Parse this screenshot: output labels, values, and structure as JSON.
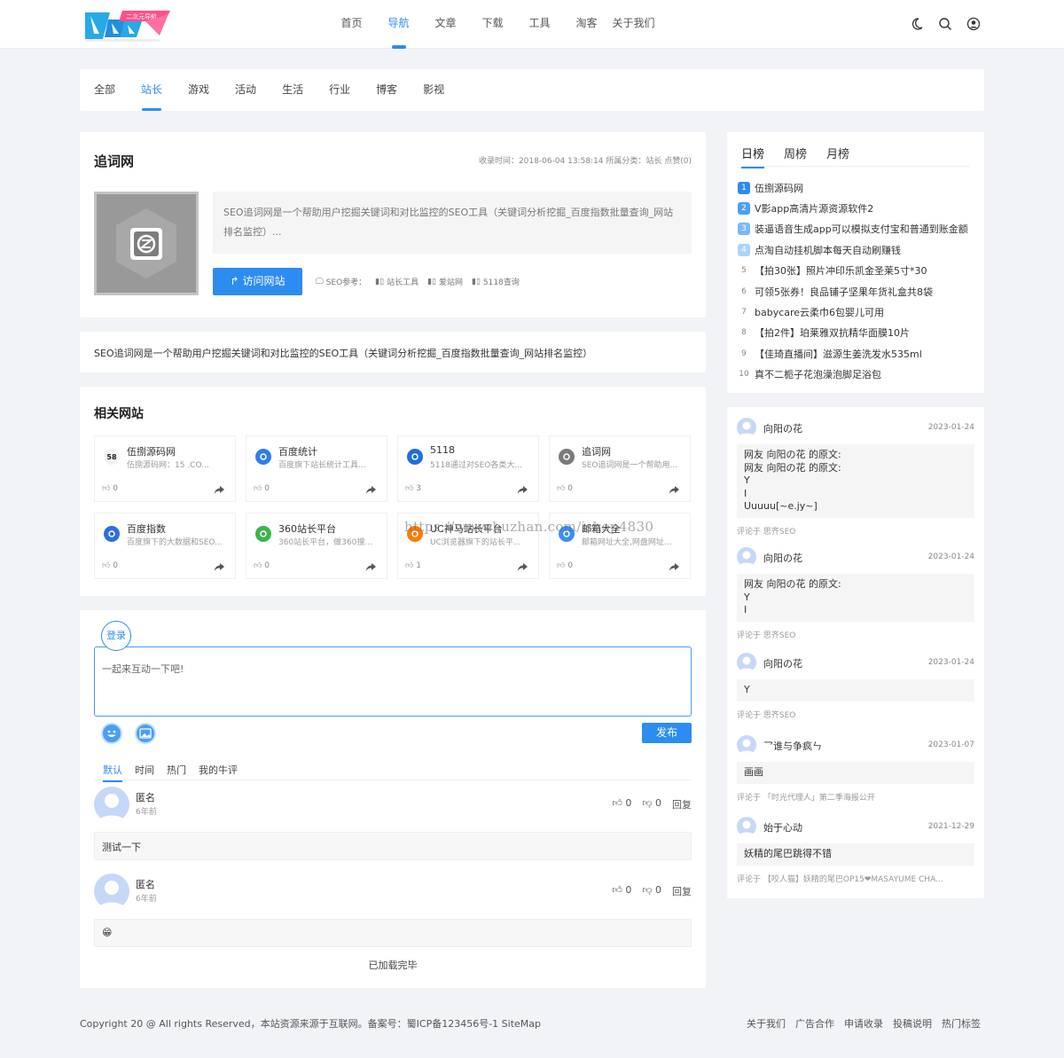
{
  "header": {
    "nav": [
      "首页",
      "导航",
      "文章",
      "下载",
      "工具",
      "淘客",
      "关于我们"
    ],
    "active_nav": 1,
    "logo_badge": "二次元导航"
  },
  "categories": [
    "全部",
    "站长",
    "游戏",
    "活动",
    "生活",
    "行业",
    "博客",
    "影视"
  ],
  "active_category": 1,
  "site": {
    "title": "追词网",
    "meta": "收录时间：2018-06-04 13:58:14 所属分类：站长 点赞(0)",
    "desc": "SEO追词网是一个帮助用户挖掘关键词和对比监控的SEO工具（关键词分析挖掘_百度指数批量查询_网站排名监控）...",
    "visit_label": "访问网站",
    "seo_label": "SEO参考：",
    "seo_links": [
      "站长工具",
      "爱站网",
      "5118查询"
    ]
  },
  "long_desc": "SEO追词网是一个帮助用户挖掘关键词和对比监控的SEO工具（关键词分析挖掘_百度指数批量查询_网站排名监控）",
  "related": {
    "title": "相关网站",
    "items": [
      {
        "name": "伍捌源码网",
        "desc": "伍捌源码网：15      .CO...",
        "likes": "0",
        "icon_text": "58",
        "color": "#f2f2f2"
      },
      {
        "name": "百度统计",
        "desc": "百度旗下站长统计工具...",
        "likes": "0",
        "icon_text": "",
        "color": "#2e7fe8"
      },
      {
        "name": "5118",
        "desc": "5118通过对SEO各类大...",
        "likes": "3",
        "icon_text": "",
        "color": "#1e6fdb"
      },
      {
        "name": "追词网",
        "desc": "SEO追词网是一个帮助用...",
        "likes": "0",
        "icon_text": "",
        "color": "#7a7a7a"
      },
      {
        "name": "百度指数",
        "desc": "百度旗下的大数据和SEO...",
        "likes": "0",
        "icon_text": "",
        "color": "#2c6fe0"
      },
      {
        "name": "360站长平台",
        "desc": "360站长平台，做360搜...",
        "likes": "0",
        "icon_text": "",
        "color": "#39b54a"
      },
      {
        "name": "UC神马站长平台",
        "desc": "UC浏览器旗下的站长平...",
        "likes": "1",
        "icon_text": "",
        "color": "#ff7a00"
      },
      {
        "name": "邮箱大全",
        "desc": "邮箱网址大全,网盘网址...",
        "likes": "0",
        "icon_text": "",
        "color": "#3b8ff2"
      }
    ]
  },
  "watermark": "https://www.huzhan.com/ishop4830",
  "comments": {
    "login_label": "登录",
    "placeholder": "一起来互动一下吧!",
    "post_label": "发布",
    "tabs": [
      "默认",
      "时间",
      "热门",
      "我的牛评"
    ],
    "active_tab": 0,
    "reply_label": "回复",
    "items": [
      {
        "name": "匿名",
        "time": "6年前",
        "up": "0",
        "down": "0",
        "body": "测试一下"
      },
      {
        "name": "匿名",
        "time": "6年前",
        "up": "0",
        "down": "0",
        "body": "😁"
      }
    ],
    "loaded_label": "已加载完毕"
  },
  "rank": {
    "tabs": [
      "日榜",
      "周榜",
      "月榜"
    ],
    "active_tab": 0,
    "items": [
      "伍捌源码网",
      "V影app高清片源资源软件2",
      "装逼语音生成app可以模拟支付宝和普通到账金额",
      "点淘自动挂机脚本每天自动刷赚钱",
      "【拍30张】照片冲印乐凯金圣莱5寸*30",
      "可领5张券！良品铺子坚果年货礼盒共8袋",
      "babycare云柔巾6包婴儿可用",
      "【拍2件】珀莱雅双抗精华面膜10片",
      "【佳琦直播间】滋源生姜洗发水535ml",
      "真不二栀子花泡澡泡脚足浴包"
    ]
  },
  "recent_comments": [
    {
      "name": "向阳の花",
      "date": "2023-01-24",
      "lines": [
        "网友 向阳の花 的原文:",
        "网友 向阳の花 的原文:",
        "Y",
        "I",
        "Uuuuu[~e.jy~]"
      ],
      "foot": "评论于 思齐SEO"
    },
    {
      "name": "向阳の花",
      "date": "2023-01-24",
      "lines": [
        "网友 向阳の花 的原文:",
        "Y",
        "I"
      ],
      "foot": "评论于 思齐SEO"
    },
    {
      "name": "向阳の花",
      "date": "2023-01-24",
      "lines": [
        "Y"
      ],
      "foot": "评论于 思齐SEO"
    },
    {
      "name": "乛谁与争疯ㄣ",
      "date": "2023-01-07",
      "lines": [
        "画画"
      ],
      "foot": "评论于 「时光代理人」第二季海报公开"
    },
    {
      "name": "始于心动",
      "date": "2021-12-29",
      "lines": [
        "妖精的尾巴跳得不错"
      ],
      "foot": "评论于 【咬人猫】妖精的尾巴OP15❤MASAYUME CHA..."
    }
  ],
  "footer": {
    "copyright": "Copyright 20          @ All rights Reserved，本站资源来源于互联网。备案号：蜀ICP备123456号-1 SiteMap",
    "links": [
      "关于我们",
      "广告合作",
      "申请收录",
      "投稿说明",
      "热门标签"
    ]
  },
  "colors": {
    "accent": "#2d8cf0",
    "background": "#f1f3f7"
  }
}
